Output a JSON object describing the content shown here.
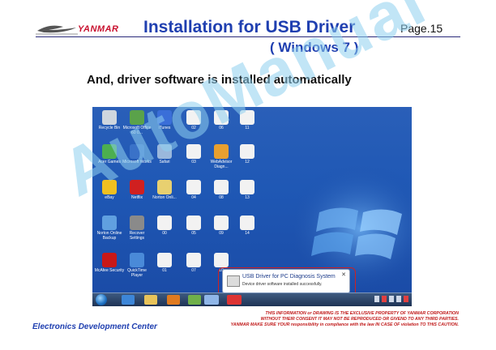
{
  "header": {
    "logo_text": "YANMAR",
    "title": "Installation for USB Driver",
    "subtitle": "( Windows 7 )",
    "page": "Page.15"
  },
  "body": {
    "lead": "And, driver software is installed automatically",
    "watermark": "AutoManual"
  },
  "desktop": {
    "icons": [
      {
        "label": "Recycle Bin",
        "color": "#cfd6de"
      },
      {
        "label": "Microsoft Office 60 0...",
        "color": "#5aa24a"
      },
      {
        "label": "iTunes",
        "color": "#3a6ed8"
      },
      {
        "label": "02",
        "color": "#f2f2f2"
      },
      {
        "label": "06",
        "color": "#f2f2f2"
      },
      {
        "label": "11",
        "color": "#f2f2f2"
      },
      {
        "label": "Acer Games",
        "color": "#4caf50"
      },
      {
        "label": "Microsoft Works",
        "color": "#3a72c8"
      },
      {
        "label": "Safari",
        "color": "#9ab8dc"
      },
      {
        "label": "03",
        "color": "#f2f2f2"
      },
      {
        "label": "WebAdvisor Diagn...",
        "color": "#e8a030"
      },
      {
        "label": "12",
        "color": "#f2f2f2"
      },
      {
        "label": "eBay",
        "color": "#f0c020"
      },
      {
        "label": "Netflix",
        "color": "#d02020"
      },
      {
        "label": "Norton Onli...",
        "color": "#e8d070"
      },
      {
        "label": "04",
        "color": "#f2f2f2"
      },
      {
        "label": "08",
        "color": "#f2f2f2"
      },
      {
        "label": "13",
        "color": "#f2f2f2"
      },
      {
        "label": "Norton Online Backup",
        "color": "#60a0e0"
      },
      {
        "label": "Recover Settings",
        "color": "#8a8a8a"
      },
      {
        "label": "00",
        "color": "#f2f2f2"
      },
      {
        "label": "05",
        "color": "#f2f2f2"
      },
      {
        "label": "09",
        "color": "#f2f2f2"
      },
      {
        "label": "14",
        "color": "#f2f2f2"
      },
      {
        "label": "McAfee Security",
        "color": "#c81818"
      },
      {
        "label": "QuickTime Player",
        "color": "#4a8ad8"
      },
      {
        "label": "01",
        "color": "#f2f2f2"
      },
      {
        "label": "07",
        "color": "#f2f2f2"
      },
      {
        "label": "10",
        "color": "#f2f2f2"
      }
    ],
    "notification": {
      "title": "USB Driver for PC Diagnosis System",
      "detail": "Device driver software installed successfully.",
      "close": "✕"
    }
  },
  "footer": {
    "left": "Electronics  Development  Center",
    "disclaimer": [
      "THIS INFORMATION or DRAWING IS THE EXCLUSIVE PROPERTY OF YANMAR CORPORATION",
      "WITHOUT THEIR CONSENT IT MAY NOT BE REPRODUCED OR GIVEND TO ANY THIRD PARTIES.",
      "YANMAR MAKE SURE YOUR responsibility in compliance with the law IN CASE OF violation TO THIS CAUTION."
    ]
  }
}
